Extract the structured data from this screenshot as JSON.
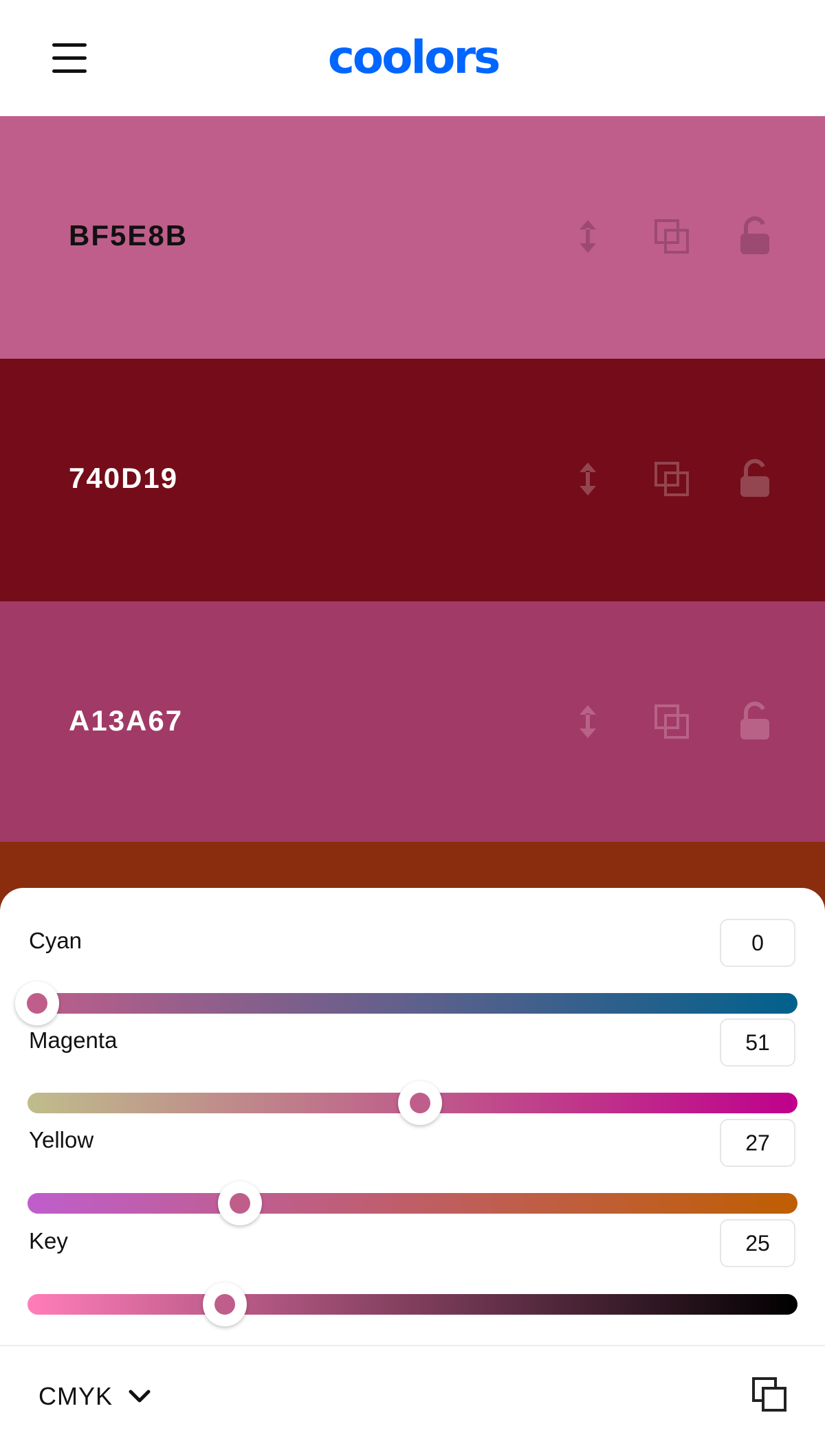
{
  "brand": {
    "name": "coolors",
    "color": "#0066FF"
  },
  "header": {
    "menu_icon": "hamburger-menu-icon"
  },
  "swatches": [
    {
      "hex": "BF5E8B",
      "color": "#BF5E8B",
      "text_color": "#111111",
      "icon_color": "#9C4A72"
    },
    {
      "hex": "740D19",
      "color": "#740D19",
      "text_color": "#FFFFFF",
      "icon_color": "#934550"
    },
    {
      "hex": "A13A67",
      "color": "#A13A67",
      "text_color": "#FFFFFF",
      "icon_color": "#B86288"
    },
    {
      "hex": "",
      "color": "#8A2C0E"
    }
  ],
  "swatch_tools": [
    "drag-vertical-icon",
    "copy-icon",
    "unlock-icon"
  ],
  "picker": {
    "mode": "CMYK",
    "rows": [
      {
        "label": "Cyan",
        "value": "0",
        "fraction": 0.0,
        "gradient": [
          "#BF5E8B",
          "#00618C"
        ]
      },
      {
        "label": "Magenta",
        "value": "51",
        "fraction": 0.51,
        "gradient": [
          "#BFBD8B",
          "#BF008B"
        ]
      },
      {
        "label": "Yellow",
        "value": "27",
        "fraction": 0.27,
        "gradient": [
          "#BF5ECC",
          "#BF5E00"
        ]
      },
      {
        "label": "Key",
        "value": "25",
        "fraction": 0.25,
        "gradient": [
          "#FF7DBA",
          "#000000"
        ]
      }
    ]
  }
}
